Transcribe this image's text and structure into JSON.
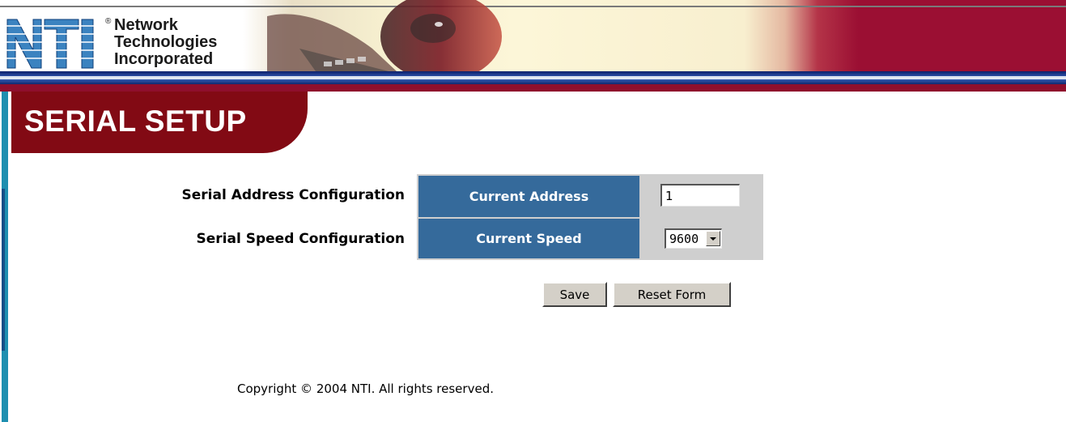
{
  "header": {
    "company_line1": "Network",
    "company_line2": "Technologies",
    "company_line3": "Incorporated",
    "registered_mark": "®",
    "logo_lettering": "NTI"
  },
  "page": {
    "title": "SERIAL SETUP"
  },
  "form": {
    "address": {
      "label": "Serial Address Configuration",
      "cell_label": "Current Address",
      "value": "1"
    },
    "speed": {
      "label": "Serial Speed Configuration",
      "cell_label": "Current Speed",
      "value": "9600"
    },
    "save_label": "Save",
    "reset_label": "Reset Form"
  },
  "footer": {
    "copyright": "Copyright © 2004 NTI. All rights reserved."
  },
  "colors": {
    "title_tab": "#820a14",
    "cell_blue": "#356a9b",
    "banner_red": "#9b0f33",
    "left_bar": "#1e8fb0"
  }
}
